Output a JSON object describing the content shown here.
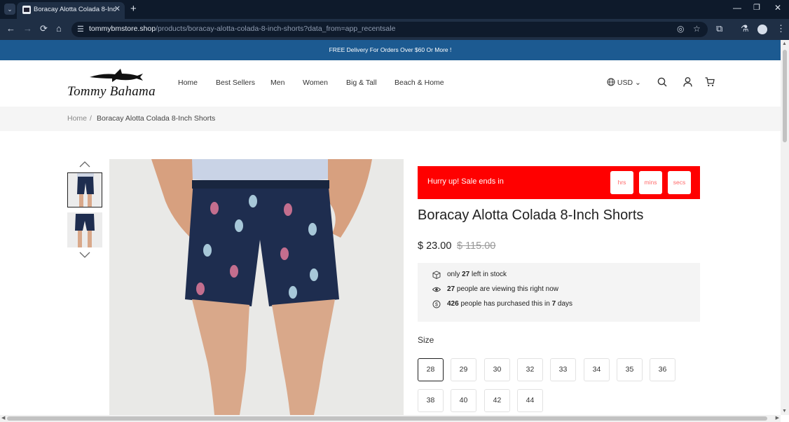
{
  "browser": {
    "tab_title": "Boracay Alotta Colada 8-Inch Sh",
    "url_domain": "tommybmstore.shop",
    "url_path": "/products/boracay-alotta-colada-8-inch-shorts?data_from=app_recentsale"
  },
  "announcement": "FREE Delivery For Orders Over $60 Or More !",
  "header": {
    "logo_text": "Tommy Bahama",
    "nav": [
      "Home",
      "Best Sellers",
      "Men",
      "Women",
      "Big & Tall",
      "Beach & Home"
    ],
    "currency": "USD"
  },
  "breadcrumb": {
    "home": "Home",
    "separator": "/",
    "current": "Boracay Alotta Colada 8-Inch Shorts"
  },
  "sale_banner": {
    "text": "Hurry up!  Sale ends in",
    "units": [
      "hrs",
      "mins",
      "secs"
    ],
    "color": "#ff0000"
  },
  "product": {
    "title": "Boracay Alotta Colada 8-Inch Shorts",
    "price": "$ 23.00",
    "old_price": "$ 115.00"
  },
  "stats": {
    "stock_pre": "only ",
    "stock_num": "27",
    "stock_post": " left in stock",
    "viewing_num": "27",
    "viewing_post": " people are viewing this right now",
    "purchased_num": "426",
    "purchased_mid": " people has purchased this in ",
    "purchased_days": "7",
    "purchased_post": " days"
  },
  "size": {
    "label": "Size",
    "options": [
      "28",
      "29",
      "30",
      "32",
      "33",
      "34",
      "35",
      "36",
      "38",
      "40",
      "42",
      "44"
    ],
    "selected": "28"
  },
  "colors": {
    "announce_bg": "#1c5a91",
    "short_navy": "#1e2d4f"
  }
}
